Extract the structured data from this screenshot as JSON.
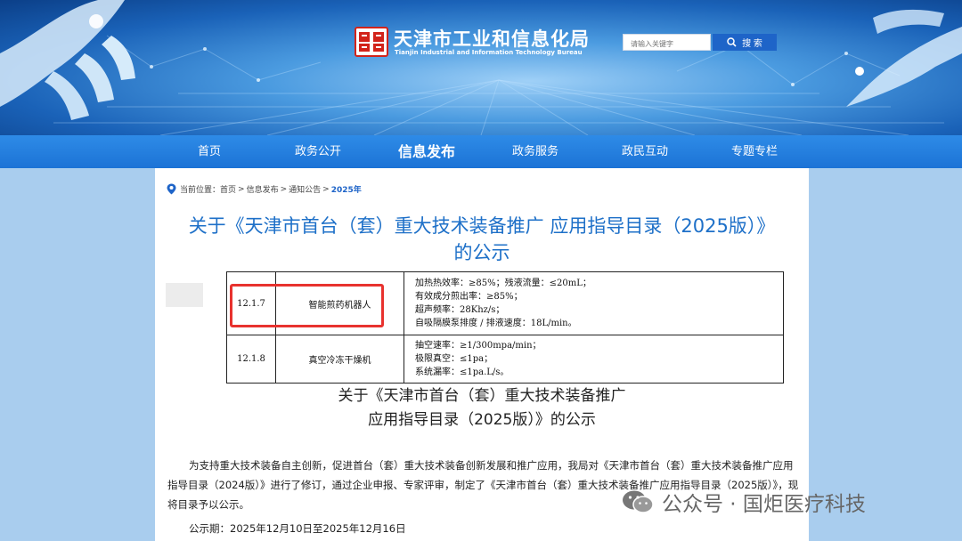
{
  "header": {
    "title": "天津市工业和信息化局",
    "subtitle": "Tianjin Industrial and Information Technology Bureau",
    "search": {
      "placeholder": "请输入关键字",
      "button_label": "搜 索"
    }
  },
  "nav": {
    "items": [
      {
        "label": "首页"
      },
      {
        "label": "政务公开"
      },
      {
        "label": "信息发布",
        "active": true
      },
      {
        "label": "政务服务"
      },
      {
        "label": "政民互动"
      },
      {
        "label": "专题专栏"
      }
    ]
  },
  "breadcrumb": {
    "prefix": "当前位置：",
    "items": [
      "首页",
      "信息发布",
      "通知公告",
      "2025年"
    ],
    "separator": ">"
  },
  "page_title": "关于《天津市首台（套）重大技术装备推广 应用指导目录（2025版）》的公示",
  "spec_table": {
    "rows": [
      {
        "code": "12.1.7",
        "name": "智能煎药机器人",
        "specs": [
          "加热热效率：≥85%；残液流量：≤20mL；",
          "有效成分煎出率：≥85%；",
          "超声频率：28Khz/s；",
          "自吸隔膜泵排度 / 排液速度：18L/min。"
        ]
      },
      {
        "code": "12.1.8",
        "name": "真空冷冻干燥机",
        "specs": [
          "抽空速率：≥1/300mpa/min；",
          "极限真空：≤1pa；",
          "系统漏率：≤1pa.L/s。"
        ]
      }
    ]
  },
  "sub_title": {
    "line1": "关于《天津市首台（套）重大技术装备推广",
    "line2": "应用指导目录（2025版）》的公示"
  },
  "body_text": "为支持重大技术装备自主创新，促进首台（套）重大技术装备创新发展和推广应用，我局对《天津市首台（套）重大技术装备推广应用指导目录（2024版）》进行了修订，通过企业申报、专家评审，制定了《天津市首台（套）重大技术装备推广应用指导目录（2025版）》，现将目录予以公示。",
  "publication_period": "公示期：2025年12月10日至2025年12月16日",
  "watermark": "公众号 · 国炬医疗科技",
  "colors": {
    "accent": "#1e64c8",
    "highlight": "#e8322e",
    "nav": "#1c73d6"
  },
  "icons": {
    "search": "search-icon",
    "location": "location-pin-icon",
    "wechat": "wechat-icon"
  }
}
